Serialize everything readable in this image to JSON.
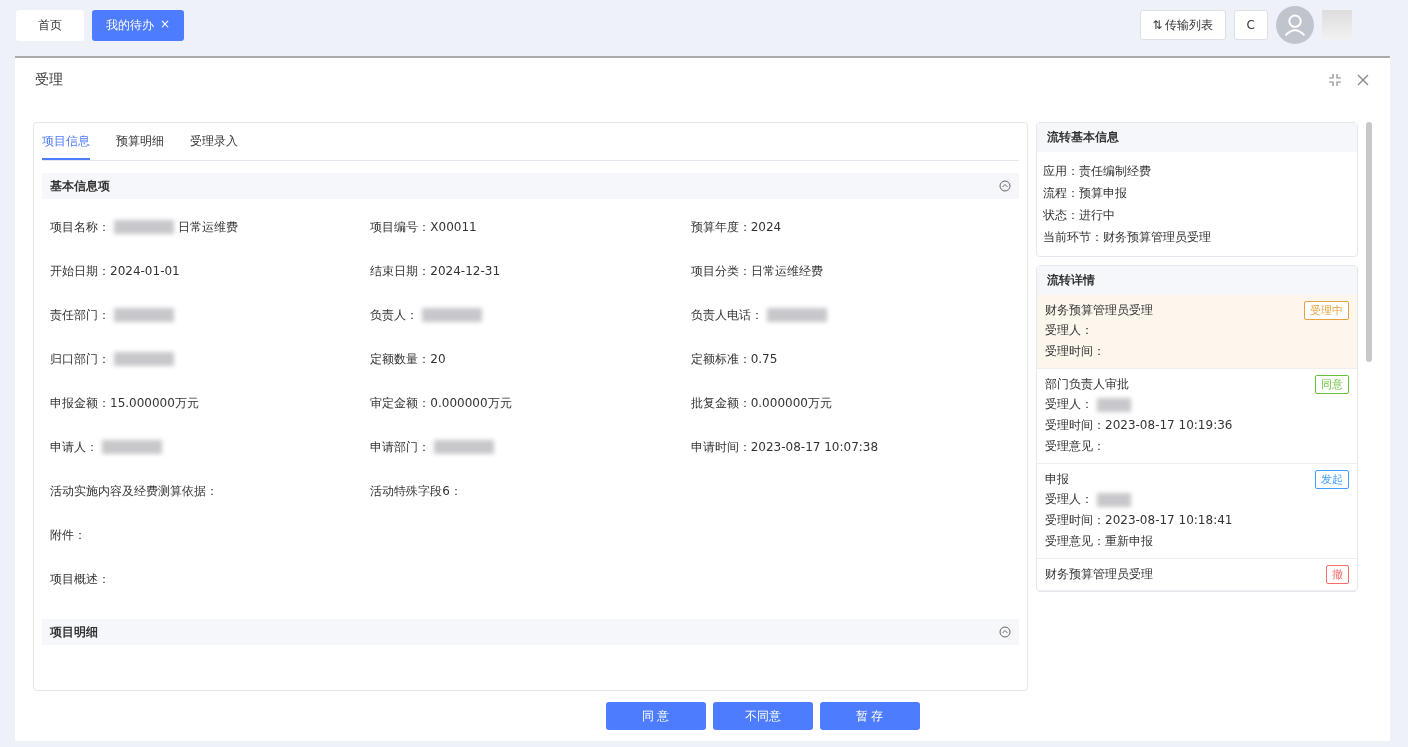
{
  "top_tabs": [
    {
      "label": "首页",
      "selected": false,
      "closable": false
    },
    {
      "label": "我的待办",
      "selected": true,
      "closable": true
    }
  ],
  "close_glyph": "×",
  "toolbar": {
    "transfer": "传输列表",
    "transfer_icon": "⇅",
    "refresh": "C"
  },
  "dialog": {
    "title": "受理",
    "tabs": [
      {
        "label": "项目信息",
        "selected": true
      },
      {
        "label": "预算明细",
        "selected": false
      },
      {
        "label": "受理录入",
        "selected": false
      }
    ],
    "section": "基本信息项",
    "fields": [
      {
        "label": "项目名称：",
        "value": "日常运维费",
        "blurred": true
      },
      {
        "label": "项目编号：",
        "value": "X00011",
        "blurred": false
      },
      {
        "label": "预算年度：",
        "value": "2024",
        "blurred": false
      },
      {
        "label": "开始日期：",
        "value": "2024-01-01",
        "blurred": false
      },
      {
        "label": "结束日期：",
        "value": "2024-12-31",
        "blurred": false
      },
      {
        "label": "项目分类：",
        "value": "日常运维经费",
        "blurred": false
      },
      {
        "label": "责任部门：",
        "blurred": true
      },
      {
        "label": "负责人：",
        "blurred": true
      },
      {
        "label": "负责人电话：",
        "blurred": true
      },
      {
        "label": "归口部门：",
        "blurred": true
      },
      {
        "label": "定额数量：",
        "value": "20",
        "blurred": false
      },
      {
        "label": "定额标准：",
        "value": "0.75",
        "blurred": false
      },
      {
        "label": "申报金额：",
        "value": "15.000000万元",
        "blurred": false
      },
      {
        "label": "审定金额：",
        "value": "0.000000万元",
        "blurred": false
      },
      {
        "label": "批复金额：",
        "value": "0.000000万元",
        "blurred": false
      },
      {
        "label": "申请人：",
        "blurred": true
      },
      {
        "label": "申请部门：",
        "blurred": true
      },
      {
        "label": "申请时间：",
        "value": "2023-08-17 10:07:38",
        "blurred": false
      },
      {
        "label": "活动实施内容及经费测算依据：",
        "blurred": false,
        "full": false
      },
      {
        "label": "活动特殊字段6：",
        "blurred": false,
        "full": false
      },
      {
        "label": "附件：",
        "blurred": false,
        "full": true
      },
      {
        "label": "项目概述：",
        "blurred": false,
        "full": true
      }
    ],
    "section2": "项目明细",
    "buttons": [
      "同 意",
      "不同意",
      "暂 存"
    ]
  },
  "flow_info": {
    "title": "流转基本信息",
    "rows": [
      {
        "label": "应用：",
        "value": "责任编制经费"
      },
      {
        "label": "流程：",
        "value": "预算申报"
      },
      {
        "label": "状态：",
        "value": "进行中"
      },
      {
        "label": "当前环节：",
        "value": "财务预算管理员受理"
      }
    ]
  },
  "flow_detail": {
    "title": "流转详情",
    "items": [
      {
        "step": "财务预算管理员受理",
        "tag": "受理中",
        "color": "#e6a23c",
        "current": true,
        "lines": [
          {
            "label": "受理人：",
            "blurred": false
          },
          {
            "label": "受理时间：",
            "blurred": false
          }
        ]
      },
      {
        "step": "部门负责人审批",
        "tag": "同意",
        "color": "#67c23a",
        "current": false,
        "lines": [
          {
            "label": "受理人：",
            "blurred": true
          },
          {
            "label": "受理时间：",
            "value": "2023-08-17 10:19:36",
            "blurred": false
          },
          {
            "label": "受理意见：",
            "blurred": false
          }
        ]
      },
      {
        "step": "申报",
        "tag": "发起",
        "color": "#409eff",
        "current": false,
        "lines": [
          {
            "label": "受理人：",
            "blurred": true
          },
          {
            "label": "受理时间：",
            "value": "2023-08-17 10:18:41",
            "blurred": false
          },
          {
            "label": "受理意见：",
            "value": "重新申报",
            "blurred": false
          }
        ]
      },
      {
        "step": "财务预算管理员受理",
        "tag": "撤",
        "color": "#f56c6c",
        "current": false
      }
    ]
  }
}
